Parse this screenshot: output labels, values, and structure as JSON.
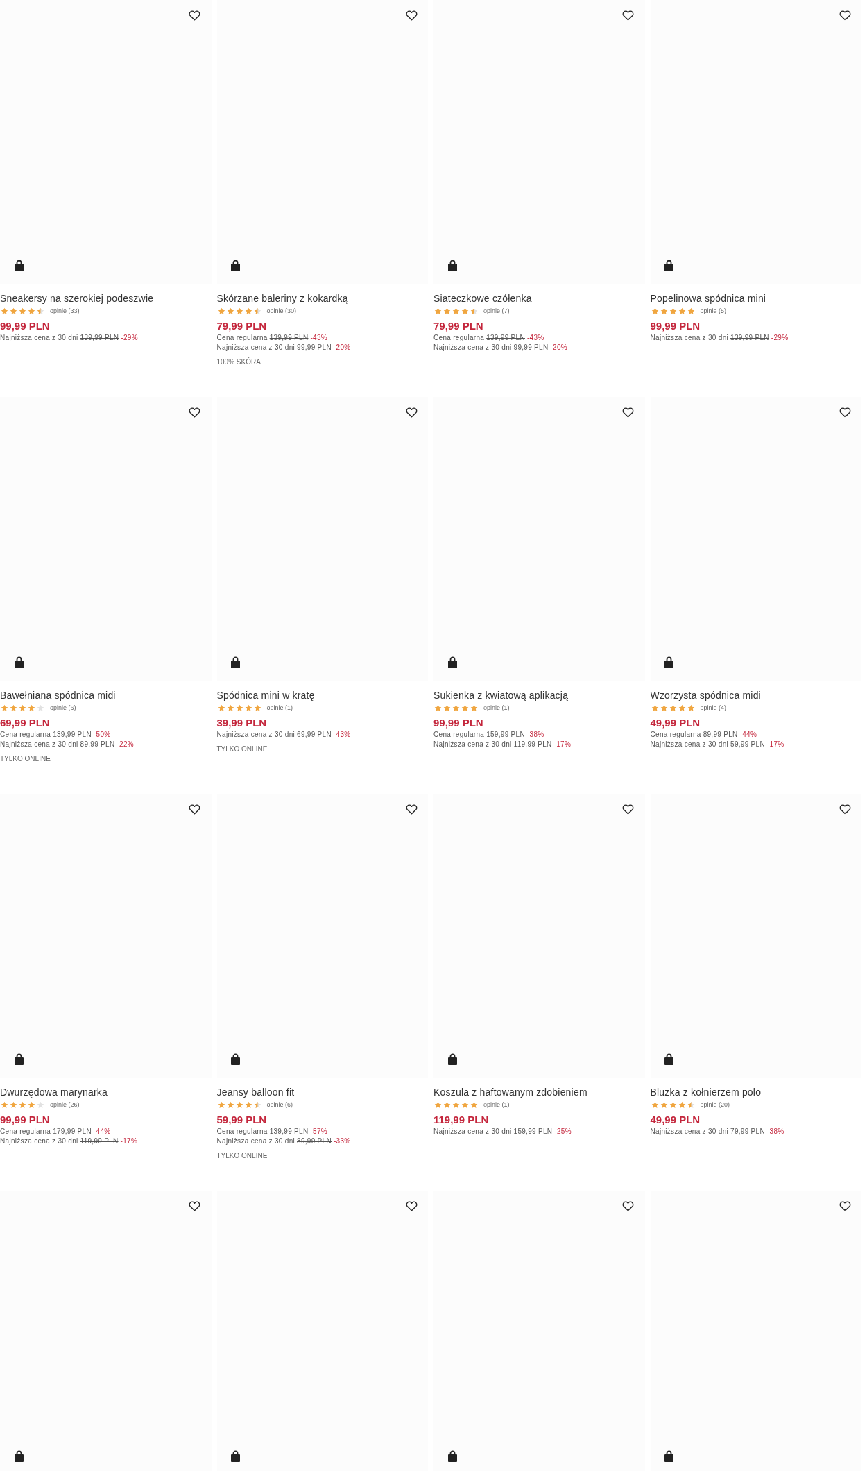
{
  "products": [
    {
      "favorite": false,
      "title": "Sneakersy na szerokiej podeszwie",
      "stars": 4.5,
      "reviews": "opinie (33)",
      "price": "99,99 PLN",
      "price_lines": [
        {
          "label": "Najniższa cena z 30 dni",
          "old_price": "139,99 PLN",
          "discount": "-29%"
        }
      ]
    },
    {
      "favorite": false,
      "title": "Skórzane baleriny z kokardką",
      "stars": 4.5,
      "reviews": "opinie (30)",
      "price": "79,99 PLN",
      "price_lines": [
        {
          "label": "Cena regularna",
          "old_price": "139,99 PLN",
          "discount": "-43%"
        },
        {
          "label": "Najniższa cena z 30 dni",
          "old_price": "99,99 PLN",
          "discount": "-20%"
        }
      ],
      "tag": "100% SKÓRA"
    },
    {
      "favorite": false,
      "title": "Siateczkowe czółenka",
      "stars": 4.5,
      "reviews": "opinie (7)",
      "price": "79,99 PLN",
      "price_lines": [
        {
          "label": "Cena regularna",
          "old_price": "139,99 PLN",
          "discount": "-43%"
        },
        {
          "label": "Najniższa cena z 30 dni",
          "old_price": "99,99 PLN",
          "discount": "-20%"
        }
      ]
    },
    {
      "favorite": false,
      "title": "Popelinowa spódnica mini",
      "stars": 5,
      "reviews": "opinie (5)",
      "price": "99,99 PLN",
      "price_lines": [
        {
          "label": "Najniższa cena z 30 dni",
          "old_price": "139,99 PLN",
          "discount": "-29%"
        }
      ]
    },
    {
      "favorite": false,
      "title": "Bawełniana spódnica midi",
      "stars": 4,
      "reviews": "opinie (6)",
      "price": "69,99 PLN",
      "price_lines": [
        {
          "label": "Cena regularna",
          "old_price": "139,99 PLN",
          "discount": "-50%"
        },
        {
          "label": "Najniższa cena z 30 dni",
          "old_price": "89,99 PLN",
          "discount": "-22%"
        }
      ],
      "tag": "TYLKO ONLINE"
    },
    {
      "favorite": false,
      "title": "Spódnica mini w kratę",
      "stars": 5,
      "reviews": "opinie (1)",
      "price": "39,99 PLN",
      "price_lines": [
        {
          "label": "Najniższa cena z 30 dni",
          "old_price": "69,99 PLN",
          "discount": "-43%"
        }
      ],
      "tag": "TYLKO ONLINE"
    },
    {
      "favorite": false,
      "title": "Sukienka z kwiatową aplikacją",
      "stars": 5,
      "reviews": "opinie (1)",
      "price": "99,99 PLN",
      "price_lines": [
        {
          "label": "Cena regularna",
          "old_price": "159,99 PLN",
          "discount": "-38%"
        },
        {
          "label": "Najniższa cena z 30 dni",
          "old_price": "119,99 PLN",
          "discount": "-17%"
        }
      ]
    },
    {
      "favorite": false,
      "title": "Wzorzysta spódnica midi",
      "stars": 5,
      "reviews": "opinie (4)",
      "price": "49,99 PLN",
      "price_lines": [
        {
          "label": "Cena regularna",
          "old_price": "89,99 PLN",
          "discount": "-44%"
        },
        {
          "label": "Najniższa cena z 30 dni",
          "old_price": "59,99 PLN",
          "discount": "-17%"
        }
      ]
    },
    {
      "favorite": false,
      "title": "Dwurzędowa marynarka",
      "stars": 4,
      "reviews": "opinie (26)",
      "price": "99,99 PLN",
      "price_lines": [
        {
          "label": "Cena regularna",
          "old_price": "179,99 PLN",
          "discount": "-44%"
        },
        {
          "label": "Najniższa cena z 30 dni",
          "old_price": "119,99 PLN",
          "discount": "-17%"
        }
      ]
    },
    {
      "favorite": false,
      "title": "Jeansy balloon fit",
      "stars": 4.5,
      "reviews": "opinie (6)",
      "price": "59,99 PLN",
      "price_lines": [
        {
          "label": "Cena regularna",
          "old_price": "139,99 PLN",
          "discount": "-57%"
        },
        {
          "label": "Najniższa cena z 30 dni",
          "old_price": "89,99 PLN",
          "discount": "-33%"
        }
      ],
      "tag": "TYLKO ONLINE"
    },
    {
      "favorite": false,
      "title": "Koszula z haftowanym zdobieniem",
      "stars": 5,
      "reviews": "opinie (1)",
      "price": "119,99 PLN",
      "price_lines": [
        {
          "label": "Najniższa cena z 30 dni",
          "old_price": "159,99 PLN",
          "discount": "-25%"
        }
      ]
    },
    {
      "favorite": false,
      "title": "Bluzka z kołnierzem polo",
      "stars": 4.5,
      "reviews": "opinie (20)",
      "price": "49,99 PLN",
      "price_lines": [
        {
          "label": "Najniższa cena z 30 dni",
          "old_price": "79,99 PLN",
          "discount": "-38%"
        }
      ]
    },
    {
      "favorite": false
    },
    {
      "favorite": false
    },
    {
      "favorite": false
    },
    {
      "favorite": false
    }
  ]
}
